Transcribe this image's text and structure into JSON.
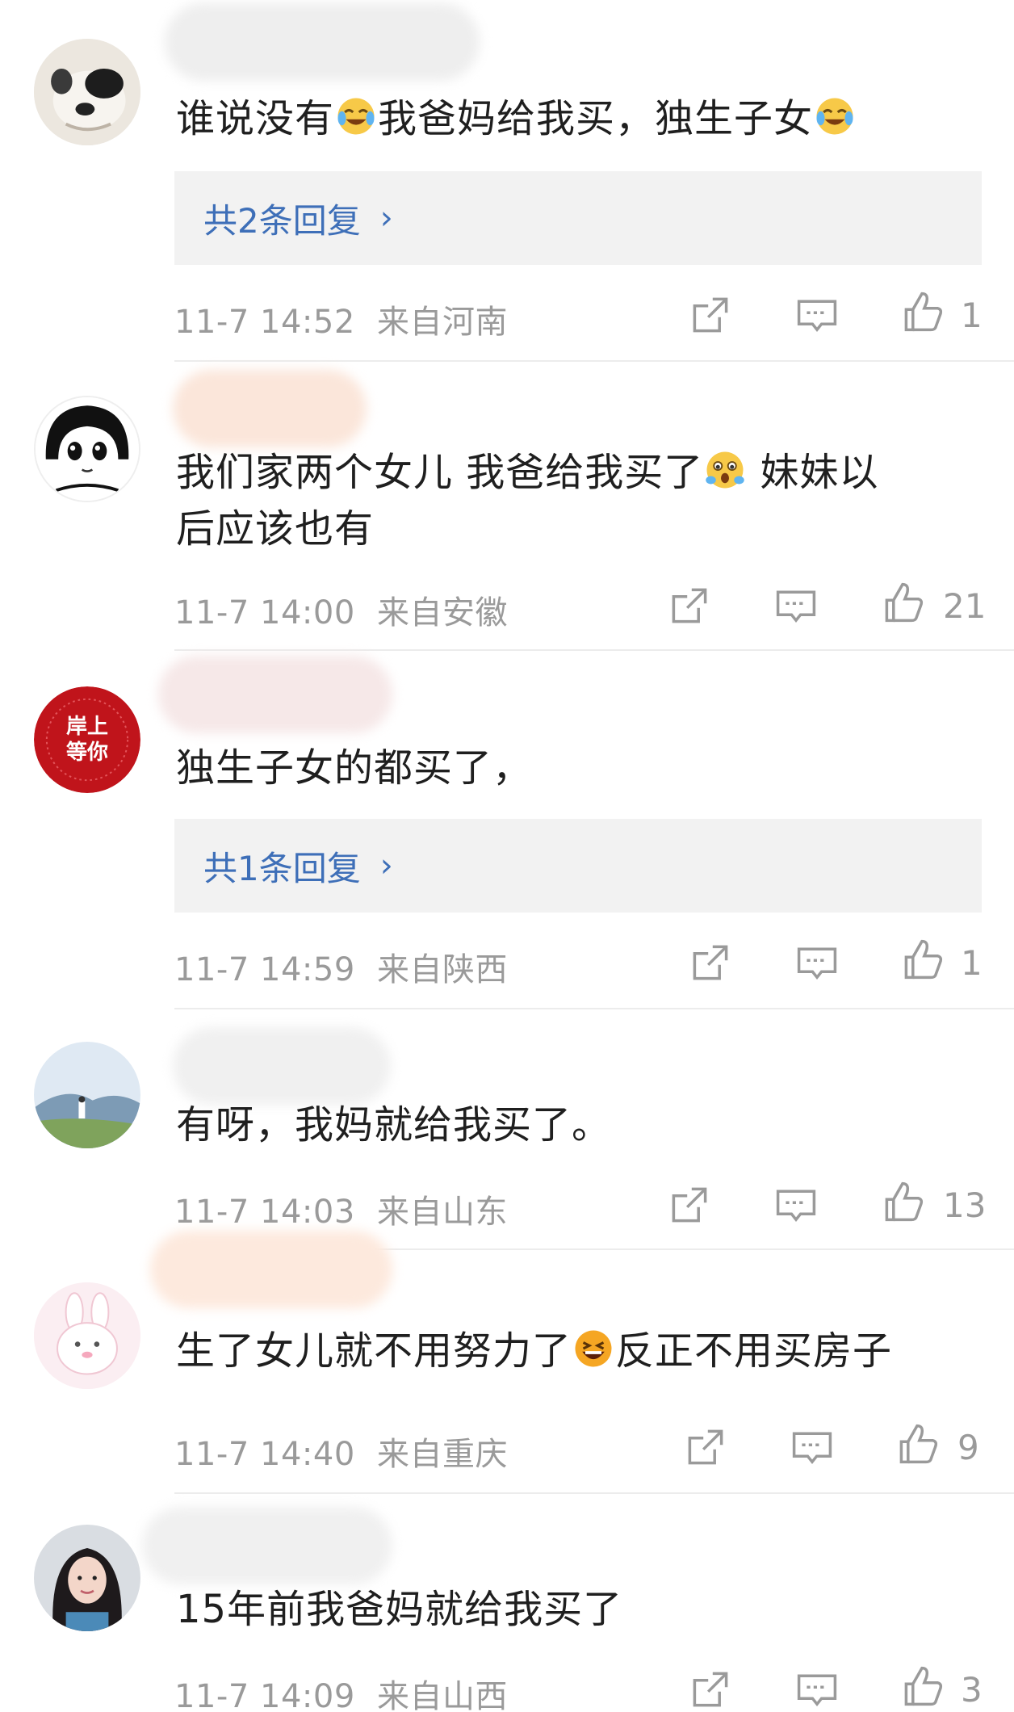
{
  "colors": {
    "link": "#3e6fb8",
    "meta": "#9a9a9a",
    "reply_bg": "#f2f2f2",
    "divider": "#ececec"
  },
  "comments": [
    {
      "avatar": "dog-avatar",
      "text_parts": [
        "谁说没有",
        "我爸妈给我买，独生子女"
      ],
      "emojis": [
        "crying-laugh-emoji",
        "crying-laugh-emoji"
      ],
      "replies_label": "共2条回复",
      "time": "11-7 14:52",
      "location": "来自河南",
      "likes": "1"
    },
    {
      "avatar": "anime-girl-avatar",
      "text_line1": "我们家两个女儿  我爸给我买了",
      "text_line1b": " 妹妹以",
      "text_line2": "后应该也有",
      "emojis": [
        "scared-emoji"
      ],
      "time": "11-7 14:00",
      "location": "来自安徽",
      "likes": "21"
    },
    {
      "avatar": "red-seal-avatar",
      "avatar_text": "岸上等你",
      "text": "独生子女的都买了，",
      "replies_label": "共1条回复",
      "time": "11-7 14:59",
      "location": "来自陕西",
      "likes": "1"
    },
    {
      "avatar": "landscape-avatar",
      "text": "有呀，我妈就给我买了。",
      "time": "11-7 14:03",
      "location": "来自山东",
      "likes": "13"
    },
    {
      "avatar": "bunny-avatar",
      "text_parts": [
        "生了女儿就不用努力了",
        "反正不用买房子"
      ],
      "emojis": [
        "laughing-emoji"
      ],
      "time": "11-7 14:40",
      "location": "来自重庆",
      "likes": "9"
    },
    {
      "avatar": "girl-photo-avatar",
      "text": "15年前我爸妈就给我买了",
      "time": "11-7 14:09",
      "location": "来自山西",
      "likes": "3"
    }
  ]
}
